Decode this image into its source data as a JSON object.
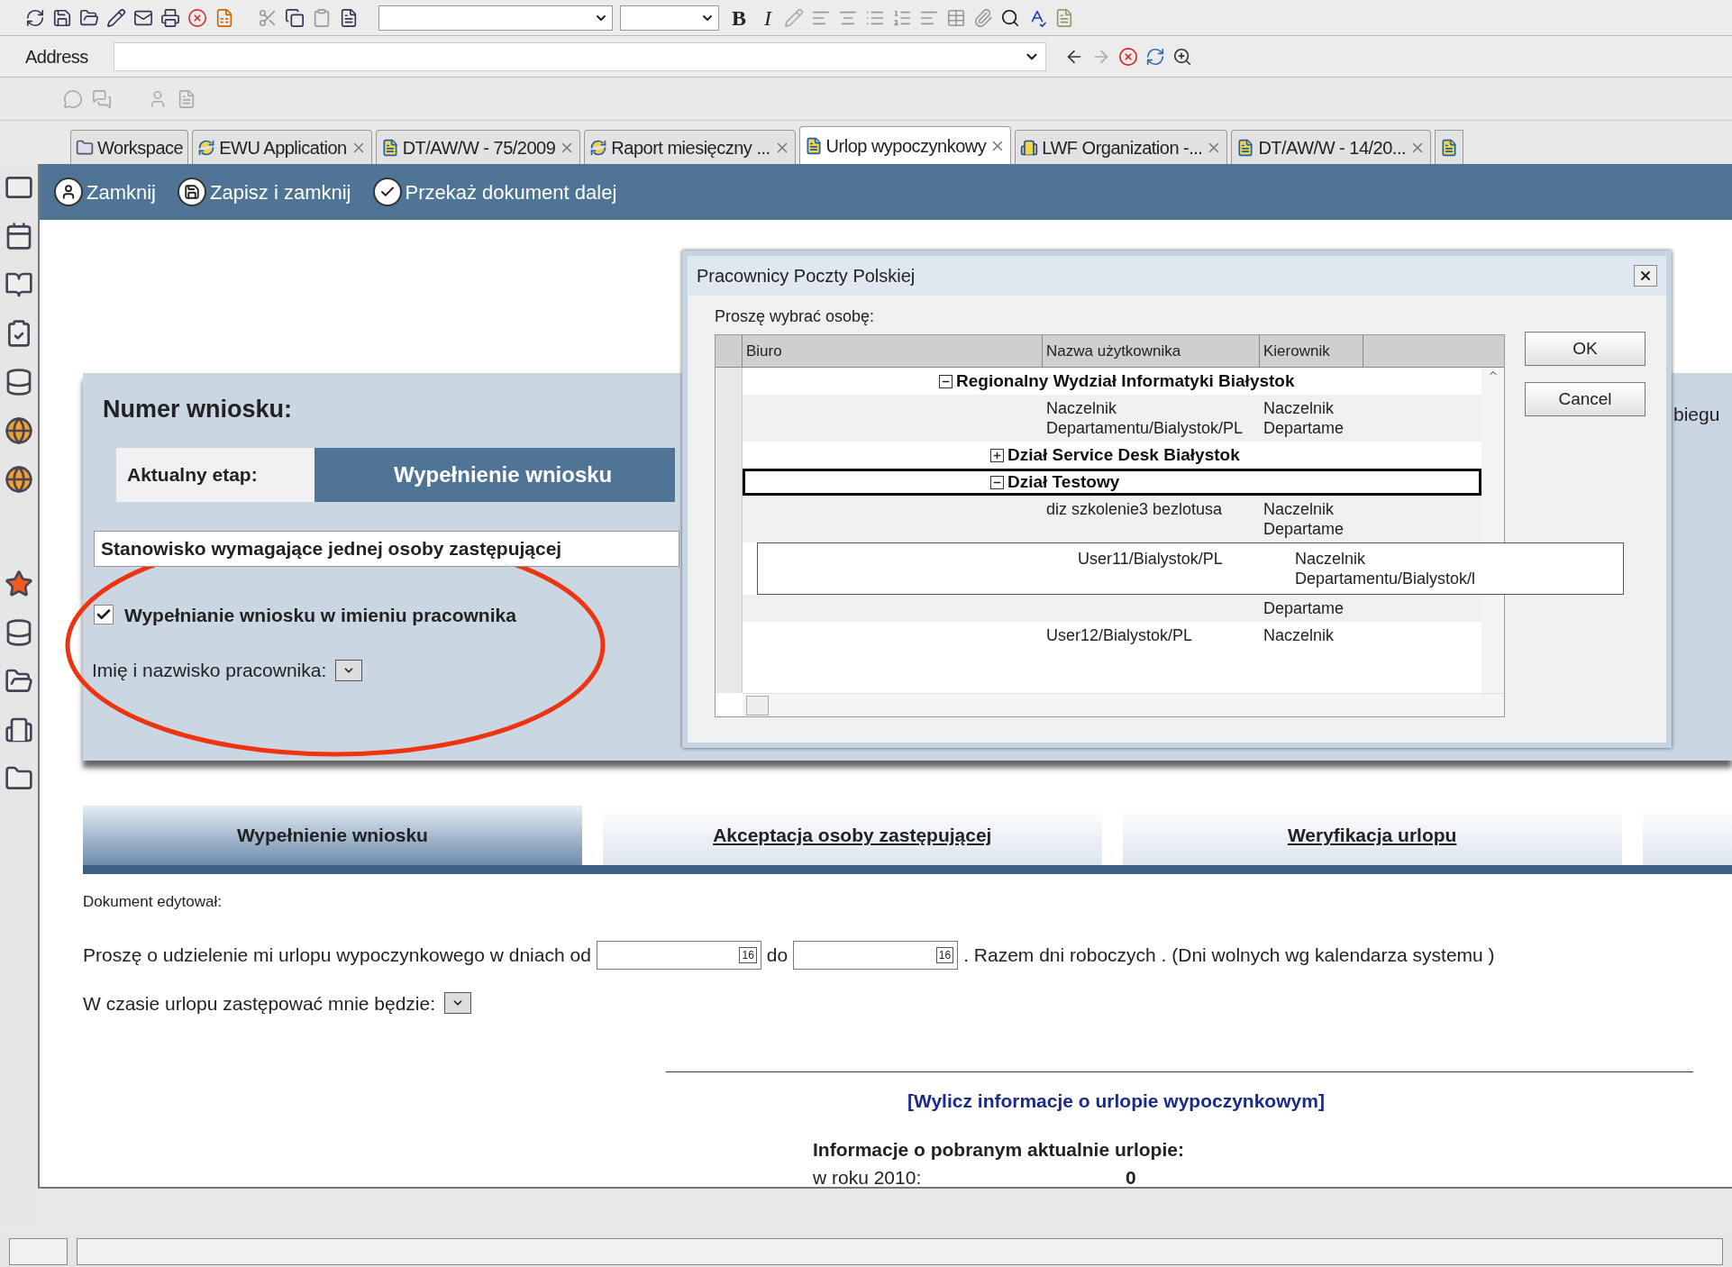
{
  "toolbar": {
    "format_buttons": [
      "B",
      "I"
    ]
  },
  "address_bar": {
    "label": "Address"
  },
  "tabs": [
    {
      "label": "Workspace",
      "closable": false,
      "selected": false
    },
    {
      "label": "EWU Application",
      "closable": true,
      "selected": false
    },
    {
      "label": "DT/AW/W - 75/2009",
      "closable": true,
      "selected": false
    },
    {
      "label": "Raport miesięczny ...",
      "closable": true,
      "selected": false
    },
    {
      "label": "Urlop wypoczynkowy",
      "closable": true,
      "selected": true
    },
    {
      "label": "LWF Organization -...",
      "closable": true,
      "selected": false
    },
    {
      "label": "DT/AW/W - 14/20...",
      "closable": true,
      "selected": false
    }
  ],
  "actions": [
    {
      "label": "Zamknij"
    },
    {
      "label": "Zapisz i zamknij"
    },
    {
      "label": "Przekaż dokument dalej"
    }
  ],
  "form": {
    "title": "Numer wniosku:",
    "stage_label": "Aktualny etap:",
    "stage_value": "Wypełnienie wniosku",
    "position_type": "Stanowisko wymagające jednej osoby zastępującej",
    "on_behalf": {
      "label": "Wypełnianie wniosku w imieniu pracownika",
      "checked": true
    },
    "employee_label": "Imię i nazwisko pracownika:",
    "right_fragment": "biegu"
  },
  "dialog": {
    "title": "Pracownicy Poczty Polskiej",
    "prompt": "Proszę wybrać osobę:",
    "columns": [
      "Biuro",
      "Nazwa użytkownika",
      "Kierownik"
    ],
    "tree": [
      {
        "kind": "group",
        "label": "Regionalny Wydział Informatyki Białystok",
        "expanded": true,
        "selected": false,
        "children": [
          {
            "kind": "person",
            "name": "Naczelnik\nDepartamentu/Bialystok/PL",
            "manager": "Naczelnik\nDepartame",
            "selected": false
          },
          {
            "kind": "group",
            "label": "Dział Service Desk Białystok",
            "expanded": false,
            "selected": false
          },
          {
            "kind": "group",
            "label": "Dział Testowy",
            "expanded": true,
            "selected": true,
            "children": [
              {
                "kind": "person",
                "name": "diz szkolenie3 bezlotusa",
                "manager": "Naczelnik\nDepartame",
                "selected": false
              },
              {
                "kind": "person",
                "name": "User11/Bialystok/PL",
                "manager": "Naczelnik\nDepartamentu/Bialystok/l",
                "selected": true
              },
              {
                "kind": "person",
                "manager": "Departame",
                "selected": false
              },
              {
                "kind": "person",
                "name": "User12/Bialystok/PL",
                "manager": "Naczelnik",
                "selected": false
              }
            ]
          }
        ]
      }
    ],
    "buttons": [
      "OK",
      "Cancel"
    ]
  },
  "stages": [
    {
      "label": "Wypełnienie wniosku",
      "selected": true
    },
    {
      "label": "Akceptacja osoby zastępującej",
      "selected": false
    },
    {
      "label": "Weryfikacja urlopu",
      "selected": false
    }
  ],
  "edited_by": "Dokument edytował:",
  "request": {
    "text_before": "Proszę o udzielenie mi urlopu wypoczynkowego w dniach od",
    "date_from_day": "16",
    "between": "do",
    "date_to_day": "16",
    "text_after": ". Razem dni roboczych . (Dni wolnych wg kalendarza systemu )"
  },
  "substitute_label": "W czasie urlopu zastępować mnie będzie:",
  "calc_link": "[Wylicz informacje o urlopie wypoczynkowym]",
  "leave_info": {
    "heading": "Informacje o pobranym aktualnie urlopie:",
    "year_label": "w roku 2010:",
    "year_value": "0"
  }
}
